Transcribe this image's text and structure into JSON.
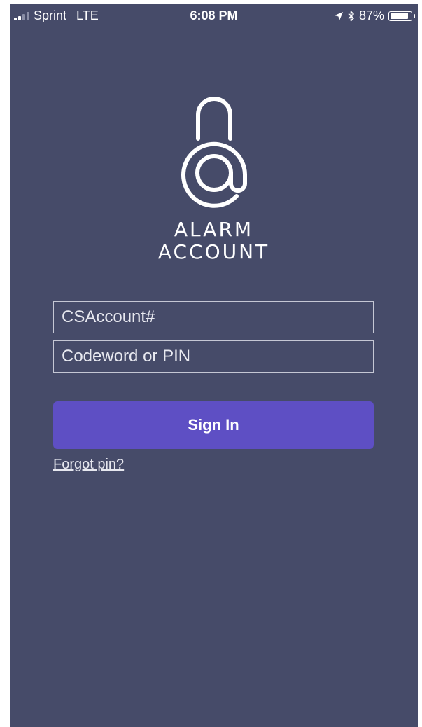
{
  "status_bar": {
    "carrier": "Sprint",
    "network": "LTE",
    "time": "6:08 PM",
    "battery_percent": "87%",
    "battery_level": 0.87,
    "icons": [
      "signal-icon",
      "location-arrow-icon",
      "bluetooth-icon",
      "battery-icon"
    ]
  },
  "brand": {
    "line1": "ALARM",
    "line2": "ACCOUNT",
    "logo_icon": "padlock-at-icon"
  },
  "login_form": {
    "account_placeholder": "CSAccount#",
    "account_value": "",
    "pin_placeholder": "Codeword or PIN",
    "pin_value": "",
    "sign_in_label": "Sign In",
    "forgot_label": "Forgot pin?"
  },
  "colors": {
    "background": "#464b69",
    "button": "#5e4fc4",
    "text": "#ffffff"
  }
}
